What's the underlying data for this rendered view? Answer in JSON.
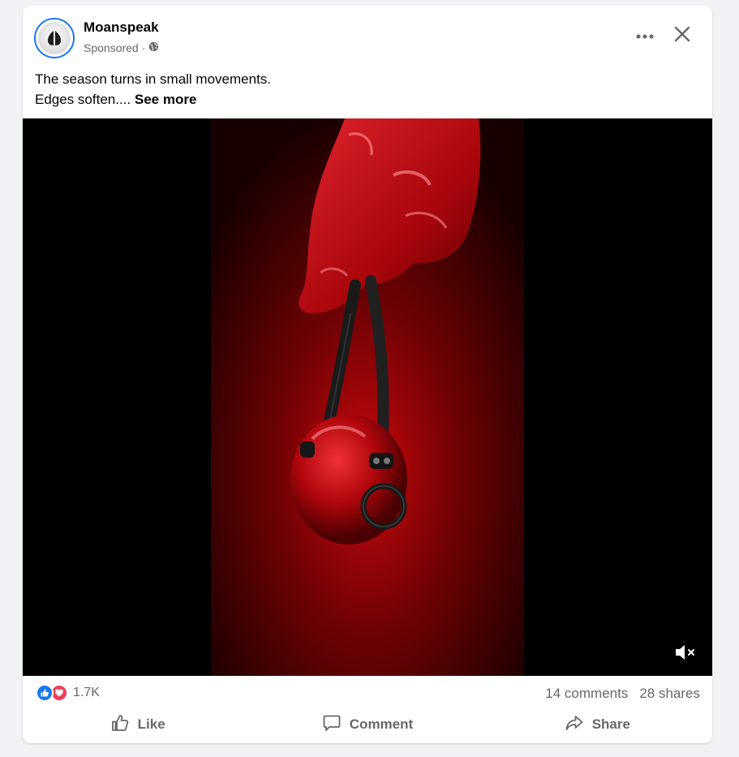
{
  "post": {
    "page_name": "Moanspeak",
    "sponsored_label": "Sponsored",
    "separator": "·",
    "caption_line1": "The season turns in small movements.",
    "caption_line2": "Edges soften....",
    "see_more_label": "See more"
  },
  "icons": {
    "avatar": "moanspeak-logo-icon",
    "audience": "globe-icon",
    "more": "more-options-icon",
    "close": "close-icon",
    "mute": "muted-speaker-icon",
    "like_reaction": "like-reaction-icon",
    "love_reaction": "love-reaction-icon",
    "like_action": "thumbs-up-icon",
    "comment_action": "comment-icon",
    "share_action": "share-icon"
  },
  "stats": {
    "reaction_count": "1.7K",
    "comments": "14 comments",
    "shares": "28 shares"
  },
  "actions": {
    "like": "Like",
    "comment": "Comment",
    "share": "Share"
  },
  "colors": {
    "accent": "#1877f2",
    "love": "#f33e58",
    "muted_text": "#65676b",
    "video_red": "#b1040a"
  }
}
